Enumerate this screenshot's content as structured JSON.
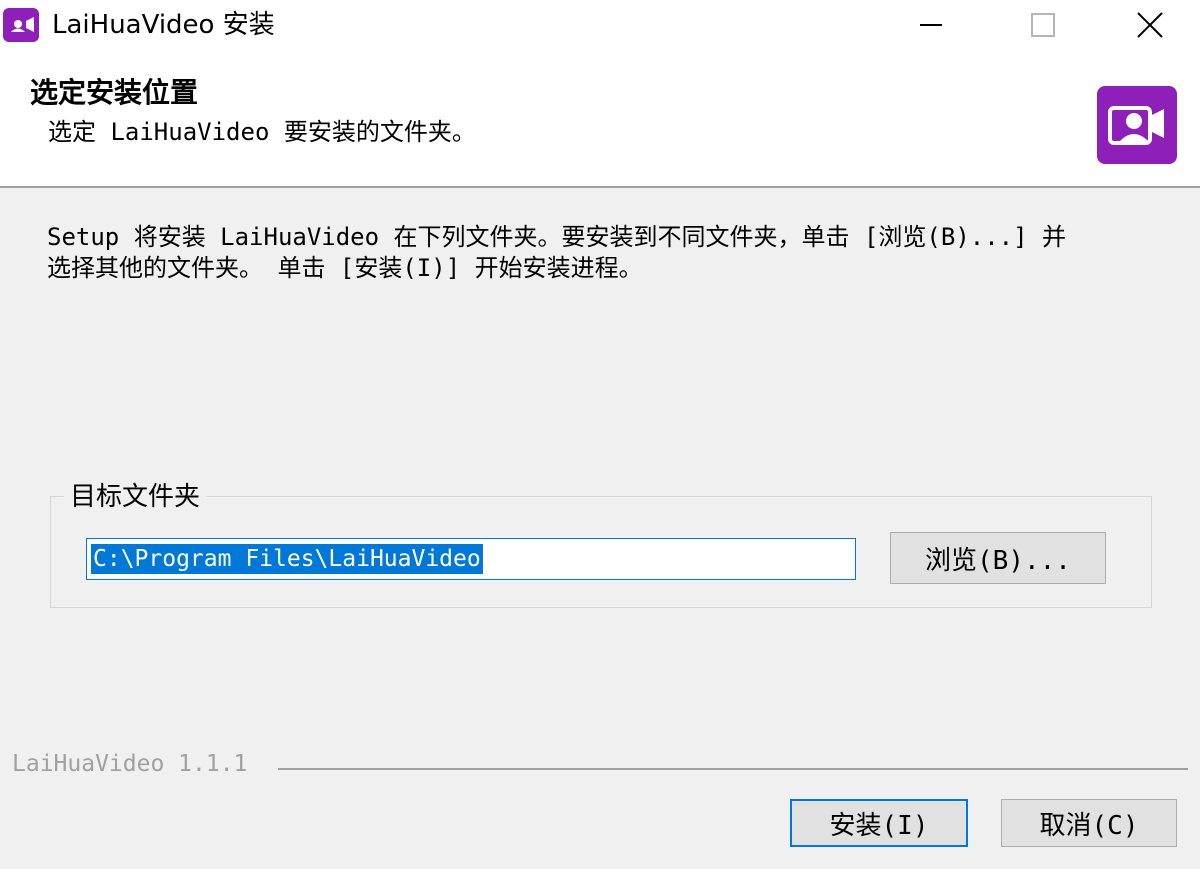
{
  "window": {
    "title": "LaiHuaVideo 安装",
    "icon": "laihua-video-icon",
    "controls": {
      "minimize": "minimize-icon",
      "maximize": "maximize-icon",
      "close": "close-icon"
    }
  },
  "header": {
    "title": "选定安装位置",
    "subtitle": "选定 LaiHuaVideo 要安装的文件夹。",
    "logo": "laihua-video-logo",
    "accent_color": "#8e1fb8"
  },
  "body": {
    "description": "Setup 将安装 LaiHuaVideo 在下列文件夹。要安装到不同文件夹，单击 [浏览(B)...] 并选择其他的文件夹。 单击 [安装(I)] 开始安装进程。"
  },
  "destination": {
    "group_label": "目标文件夹",
    "path_value": "C:\\Program Files\\LaiHuaVideo",
    "browse_label": "浏览(B)..."
  },
  "footer": {
    "version": "LaiHuaVideo 1.1.1",
    "install_label": "安装(I)",
    "cancel_label": "取消(C)"
  },
  "colors": {
    "focus_blue": "#0078d7",
    "dialog_background": "#f0f0f0"
  }
}
